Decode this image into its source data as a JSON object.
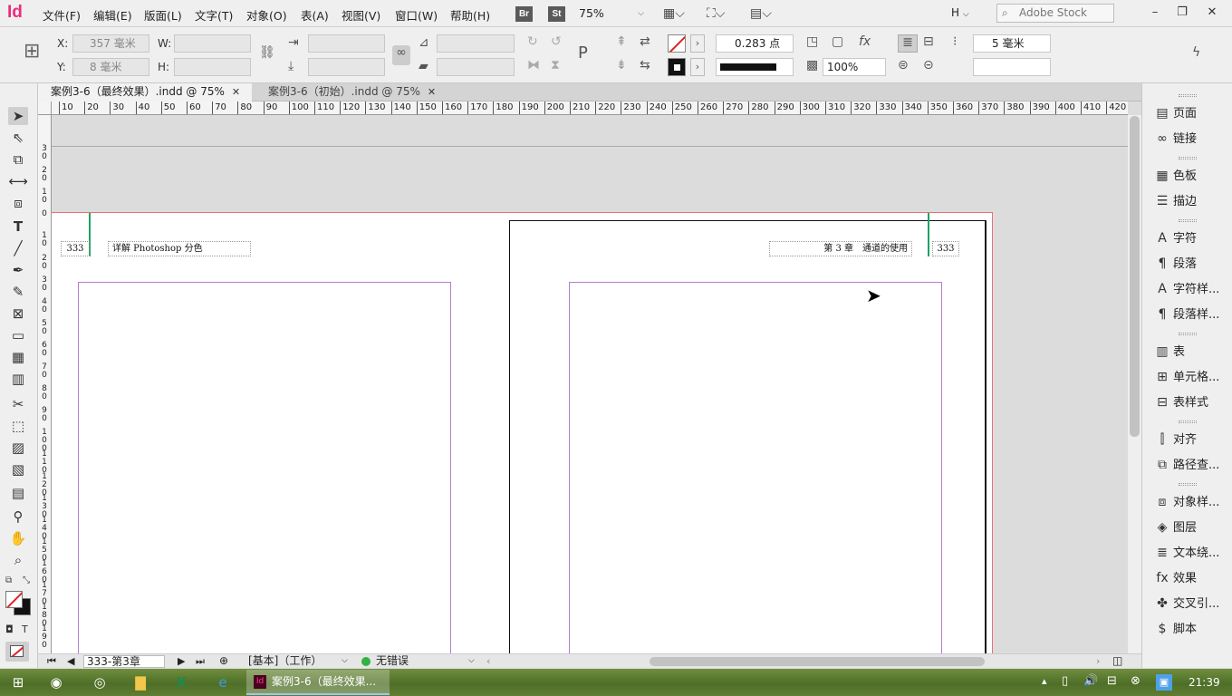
{
  "app": {
    "logo": "Id"
  },
  "menu": [
    "文件(F)",
    "编辑(E)",
    "版面(L)",
    "文字(T)",
    "对象(O)",
    "表(A)",
    "视图(V)",
    "窗口(W)",
    "帮助(H)"
  ],
  "bridge_badges": [
    "Br",
    "St"
  ],
  "zoom": "75%",
  "workspace": "H",
  "stock_search": {
    "placeholder": "Adobe Stock"
  },
  "control": {
    "x_label": "X:",
    "x_value": "357 毫米",
    "y_label": "Y:",
    "y_value": "8 毫米",
    "w_label": "W:",
    "h_label": "H:",
    "stroke_weight": "0.283 点",
    "opacity": "100%",
    "gap": "5 毫米"
  },
  "tabs": [
    {
      "label": "案例3-6（最终效果）.indd @ 75%",
      "close": "✕"
    },
    {
      "label": "案例3-6（初始）.indd @ 75%",
      "close": "✕"
    }
  ],
  "ruler_h": [
    "10",
    "20",
    "30",
    "40",
    "50",
    "60",
    "70",
    "80",
    "90",
    "100",
    "110",
    "120",
    "130",
    "140",
    "150",
    "160",
    "170",
    "180",
    "190",
    "200",
    "210",
    "220",
    "230",
    "240",
    "250",
    "260",
    "270",
    "280",
    "290",
    "300",
    "310",
    "320",
    "330",
    "340",
    "350",
    "360",
    "370",
    "380",
    "390",
    "400",
    "410",
    "420"
  ],
  "ruler_v": [
    "3\n0",
    "2\n0",
    "1\n0",
    "0",
    "1\n0",
    "2\n0",
    "3\n0",
    "4\n0",
    "5\n0",
    "6\n0",
    "7\n0",
    "8\n0",
    "9\n0",
    "1\n0\n0",
    "1\n1\n0",
    "1\n2\n0",
    "1\n3\n0",
    "1\n4\n0",
    "1\n5\n0",
    "1\n6\n0",
    "1\n7\n0",
    "1\n8\n0",
    "1\n9\n0"
  ],
  "document": {
    "left_page_number": "333",
    "left_header": "详解 Photoshop 分色",
    "right_header": "第 3 章　通道的使用",
    "right_page_number": "333"
  },
  "panels": [
    {
      "label": "页面",
      "icon": "pages-icon"
    },
    {
      "label": "链接",
      "icon": "links-icon"
    },
    {
      "label": "色板",
      "icon": "swatches-icon"
    },
    {
      "label": "描边",
      "icon": "stroke-icon"
    },
    {
      "label": "字符",
      "icon": "character-icon"
    },
    {
      "label": "段落",
      "icon": "paragraph-icon"
    },
    {
      "label": "字符样...",
      "icon": "character-styles-icon"
    },
    {
      "label": "段落样...",
      "icon": "paragraph-styles-icon"
    },
    {
      "label": "表",
      "icon": "table-icon"
    },
    {
      "label": "单元格...",
      "icon": "cell-styles-icon"
    },
    {
      "label": "表样式",
      "icon": "table-styles-icon"
    },
    {
      "label": "对齐",
      "icon": "align-icon"
    },
    {
      "label": "路径查...",
      "icon": "pathfinder-icon"
    },
    {
      "label": "对象样...",
      "icon": "object-styles-icon"
    },
    {
      "label": "图层",
      "icon": "layers-icon"
    },
    {
      "label": "文本绕...",
      "icon": "text-wrap-icon"
    },
    {
      "label": "效果",
      "icon": "effects-icon"
    },
    {
      "label": "交叉引...",
      "icon": "cross-references-icon"
    },
    {
      "label": "脚本",
      "icon": "scripts-icon"
    }
  ],
  "status": {
    "page_select": "333-第3章",
    "style": "[基本]（工作）",
    "preflight": "无错误"
  },
  "taskbar": {
    "active_task": "案例3-6（最终效果...",
    "clock": "21:39"
  },
  "colors": {
    "accent": "#ed2b7c",
    "bleed": "#e8707a",
    "margin": "#b57fcf",
    "guide": "#1fa266",
    "preflight_ok": "#2fb344"
  }
}
